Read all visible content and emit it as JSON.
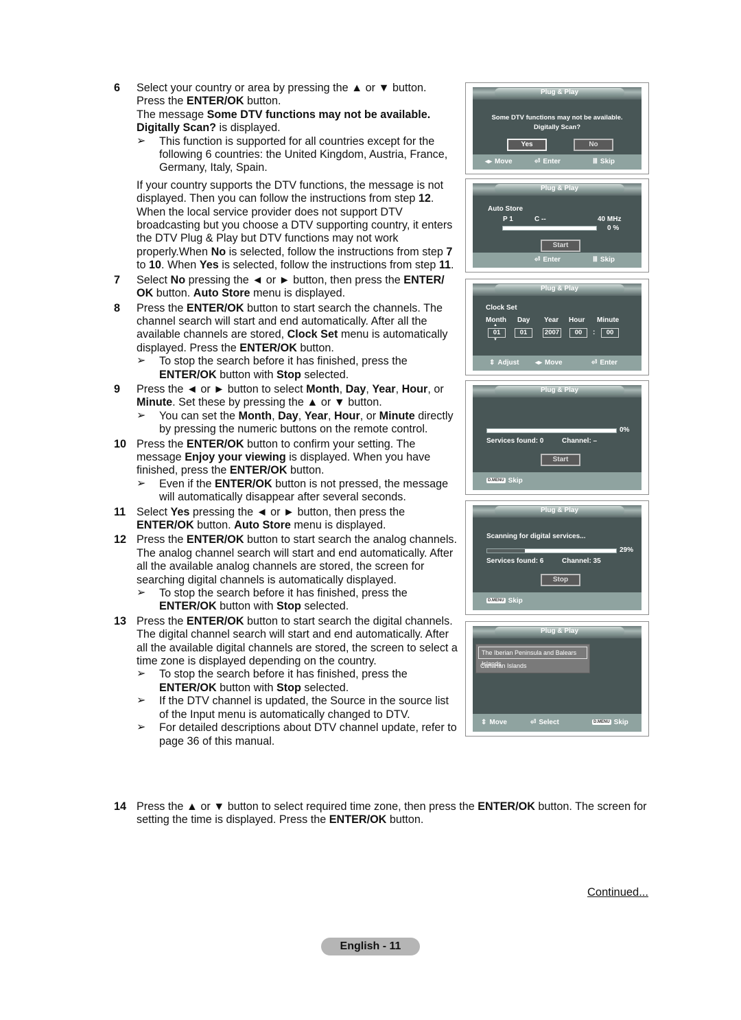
{
  "steps": {
    "s6": {
      "num": "6",
      "line1": "Select your country or area by pressing the ▲ or ▼ button.",
      "line2a": "Press the ",
      "line2b": "ENTER/OK",
      "line2c": " button.",
      "line3a": "The message ",
      "line3b": "Some DTV functions may not be available. Digitally Scan?",
      "line3c": " is displayed.",
      "note": "This function is supported for all countries except for the following 6 countries: the United Kingdom, Austria, France, Germany, Italy, Spain.",
      "para_a": "If your country supports the DTV functions, the message is not displayed. Then you can follow the instructions from step ",
      "para_b": "12",
      "para_c": ". When the local service provider does not support DTV broadcasting but you choose a DTV supporting country, it enters the DTV Plug & Play but DTV functions may not work properly.When ",
      "para_d": "No",
      "para_e": " is selected, follow the instructions from step ",
      "para_f": "7",
      "para_g": " to ",
      "para_h": "10",
      "para_i": ". When ",
      "para_j": "Yes",
      "para_k": " is selected, follow the instructions from step ",
      "para_l": "11",
      "para_m": "."
    },
    "s7": {
      "num": "7",
      "a": "Select ",
      "b": "No",
      "c": " pressing the ◄ or ► button, then press the ",
      "d": "ENTER/ OK",
      "e": " button. ",
      "f": "Auto Store",
      "g": " menu is displayed."
    },
    "s8": {
      "num": "8",
      "a": "Press the ",
      "b": "ENTER/OK",
      "c": " button to start search the channels. The channel search will start and end automatically. After all the available channels are stored, ",
      "d": "Clock Set",
      "e": " menu is automatically displayed. Press the ",
      "f": "ENTER/OK",
      "g": " button.",
      "note_a": "To stop the search before it has finished, press the ",
      "note_b": "ENTER/OK",
      "note_c": " button with ",
      "note_d": "Stop",
      "note_e": " selected."
    },
    "s9": {
      "num": "9",
      "a": "Press the ◄ or ► button to select ",
      "b": "Month",
      "c": ", ",
      "d": "Day",
      "e": ", ",
      "f": "Year",
      "g": ", ",
      "h": "Hour",
      "i": ", or ",
      "j": "Minute",
      "k": ". Set these by pressing the ▲ or ▼ button.",
      "note_a": "You can set the ",
      "note_b": "Month",
      "note_c": ", ",
      "note_d": "Day",
      "note_e": ", ",
      "note_f": "Year",
      "note_g": ", ",
      "note_h": "Hour",
      "note_i": ", or ",
      "note_j": "Minute",
      "note_k": " directly by pressing the numeric buttons on the remote control."
    },
    "s10": {
      "num": "10",
      "a": "Press the ",
      "b": "ENTER/OK",
      "c": " button to confirm your setting. The message ",
      "d": "Enjoy your viewing",
      "e": " is displayed. When you have finished, press the ",
      "f": "ENTER/OK",
      "g": " button.",
      "note_a": "Even if the ",
      "note_b": "ENTER/OK",
      "note_c": " button is not pressed, the message will automatically disappear after several seconds."
    },
    "s11": {
      "num": "11",
      "a": "Select ",
      "b": "Yes",
      "c": " pressing the ◄ or ► button, then press the ",
      "d": "ENTER/OK",
      "e": " button. ",
      "f": "Auto Store",
      "g": " menu is displayed."
    },
    "s12": {
      "num": "12",
      "a": "Press the ",
      "b": "ENTER/OK",
      "c": " button to start search the analog channels. The analog channel search will start and end automatically. After all the available analog channels are stored, the screen for searching digital channels is automatically displayed.",
      "note_a": "To stop the search before it has finished, press the ",
      "note_b": "ENTER/OK",
      "note_c": " button with ",
      "note_d": "Stop",
      "note_e": " selected."
    },
    "s13": {
      "num": "13",
      "a": "Press the ",
      "b": "ENTER/OK",
      "c": " button to start search the digital channels. The digital channel search will start and end automatically. After all the available digital channels are stored, the screen to select a time zone is displayed depending on the country.",
      "note1_a": "To stop the search before it has finished, press the ",
      "note1_b": "ENTER/OK",
      "note1_c": " button with ",
      "note1_d": "Stop",
      "note1_e": " selected.",
      "note2": "If the DTV channel is updated, the Source in the source list of the Input menu is automatically changed to DTV.",
      "note3": "For detailed descriptions about DTV channel update, refer to page 36 of this manual."
    },
    "s14": {
      "num": "14",
      "a": "Press the ▲ or ▼ button to select required time zone, then press the ",
      "b": "ENTER/OK",
      "c": " button. The screen for setting the time is displayed. Press the ",
      "d": "ENTER/OK",
      "e": " button."
    },
    "arrow": "➢"
  },
  "screens": {
    "title": "Plug & Play",
    "s1": {
      "msg1": "Some DTV functions may not be available.",
      "msg2": "Digitally Scan?",
      "yes": "Yes",
      "no": "No",
      "foot_move": "Move",
      "foot_enter": "Enter",
      "foot_skip": "Skip"
    },
    "s2": {
      "heading": "Auto Store",
      "prog": "P  1",
      "ch": "C   --",
      "freq": "40 MHz",
      "progress_percent": 0,
      "pct": "0  %",
      "start": "Start",
      "foot_enter": "Enter",
      "foot_skip": "Skip"
    },
    "s3": {
      "heading": "Clock Set",
      "labels": [
        "Month",
        "Day",
        "Year",
        "Hour",
        "Minute"
      ],
      "values": [
        "01",
        "01",
        "2007",
        "00",
        "00"
      ],
      "sep": ":",
      "foot_adjust": "Adjust",
      "foot_move": "Move",
      "foot_enter": "Enter"
    },
    "s4": {
      "progress_percent": 0,
      "pct": "0%",
      "services": "Services found: 0",
      "channel": "Channel: –",
      "start": "Start",
      "dmenu": "D.MENU",
      "foot_skip": "Skip"
    },
    "s5": {
      "heading": "Scanning for digital services...",
      "progress_percent": 29,
      "pct": "29%",
      "services": "Services found: 6",
      "channel": "Channel: 35",
      "stop": "Stop",
      "dmenu": "D.MENU",
      "foot_skip": "Skip"
    },
    "s6": {
      "options": [
        "The Iberian Peninsula and Balears Islands",
        "Canarian Islands"
      ],
      "selected": 0,
      "foot_move": "Move",
      "foot_select": "Select",
      "dmenu": "D.MENU",
      "foot_skip": "Skip"
    }
  },
  "footer": {
    "continued": "Continued...",
    "page": "English - 11"
  }
}
